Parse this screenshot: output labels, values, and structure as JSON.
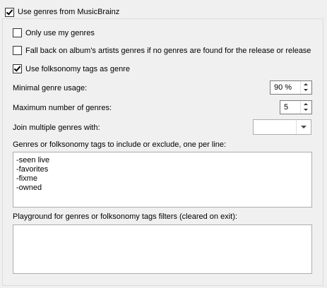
{
  "use_genres": {
    "label": "Use genres from MusicBrainz",
    "checked": true
  },
  "only_my_genres": {
    "label": "Only use my genres",
    "checked": false
  },
  "fallback_artist": {
    "label": "Fall back on album's artists genres if no genres are found for the release or release g",
    "checked": false
  },
  "use_folksonomy": {
    "label": "Use folksonomy tags as genre",
    "checked": true
  },
  "min_genre_usage": {
    "label": "Minimal genre usage:",
    "value": "90 %"
  },
  "max_genres": {
    "label": "Maximum number of genres:",
    "value": "5"
  },
  "join_genres": {
    "label": "Join multiple genres with:",
    "value": ""
  },
  "filters": {
    "label": "Genres or folksonomy tags to include or exclude, one per line:",
    "lines": [
      "-seen live",
      "-favorites",
      "-fixme",
      "-owned"
    ]
  },
  "playground": {
    "label": "Playground for genres or folksonomy tags filters (cleared on exit):",
    "value": ""
  }
}
